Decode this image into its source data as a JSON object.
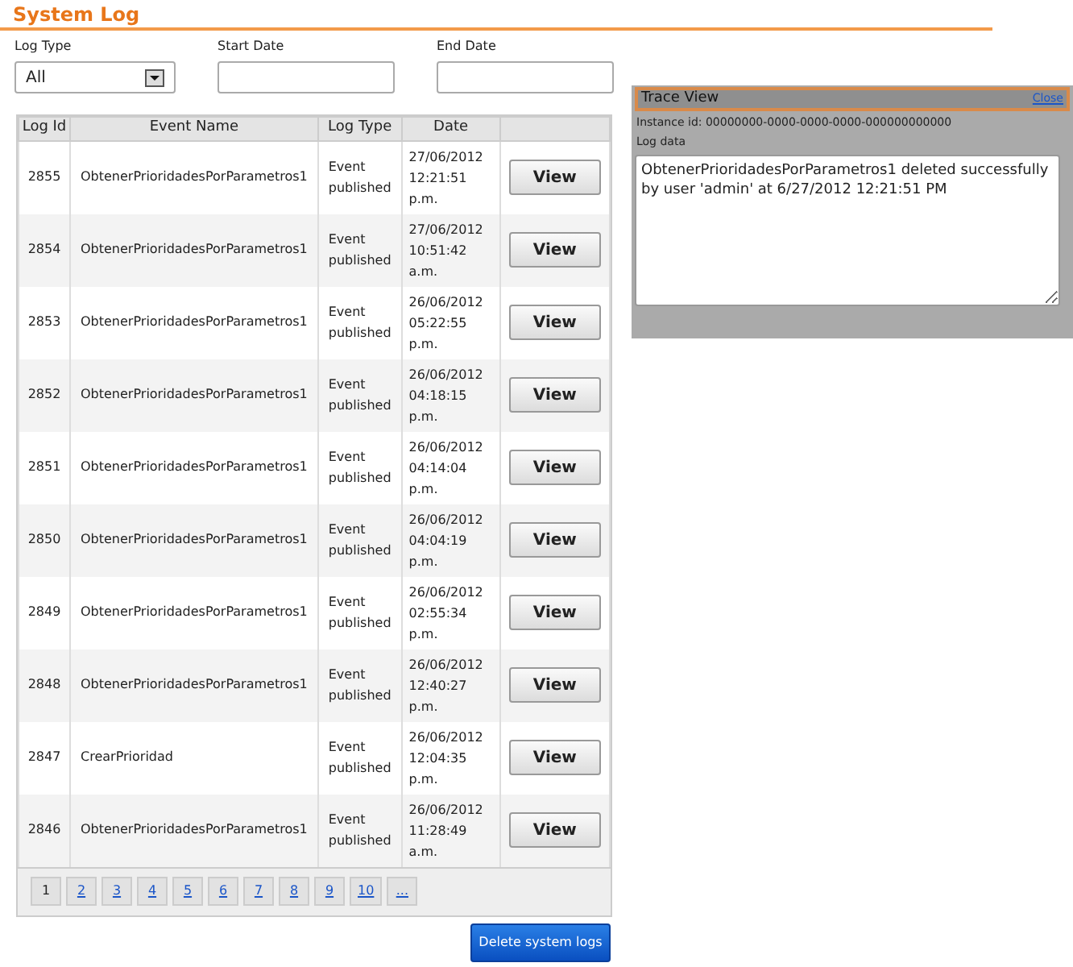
{
  "title": "System Log",
  "filters": {
    "log_type": {
      "label": "Log Type",
      "value": "All"
    },
    "start_date": {
      "label": "Start Date"
    },
    "end_date": {
      "label": "End Date"
    }
  },
  "table": {
    "columns": [
      "Log Id",
      "Event Name",
      "Log Type",
      "Date"
    ],
    "rows": [
      {
        "id": "2855",
        "event": "ObtenerPrioridadesPorParametros1",
        "type": "Event published",
        "date": "27/06/2012 12:21:51 p.m.",
        "action": "View"
      },
      {
        "id": "2854",
        "event": "ObtenerPrioridadesPorParametros1",
        "type": "Event published",
        "date": "27/06/2012 10:51:42 a.m.",
        "action": "View"
      },
      {
        "id": "2853",
        "event": "ObtenerPrioridadesPorParametros1",
        "type": "Event published",
        "date": "26/06/2012 05:22:55 p.m.",
        "action": "View"
      },
      {
        "id": "2852",
        "event": "ObtenerPrioridadesPorParametros1",
        "type": "Event published",
        "date": "26/06/2012 04:18:15 p.m.",
        "action": "View"
      },
      {
        "id": "2851",
        "event": "ObtenerPrioridadesPorParametros1",
        "type": "Event published",
        "date": "26/06/2012 04:14:04 p.m.",
        "action": "View"
      },
      {
        "id": "2850",
        "event": "ObtenerPrioridadesPorParametros1",
        "type": "Event published",
        "date": "26/06/2012 04:04:19 p.m.",
        "action": "View"
      },
      {
        "id": "2849",
        "event": "ObtenerPrioridadesPorParametros1",
        "type": "Event published",
        "date": "26/06/2012 02:55:34 p.m.",
        "action": "View"
      },
      {
        "id": "2848",
        "event": "ObtenerPrioridadesPorParametros1",
        "type": "Event published",
        "date": "26/06/2012 12:40:27 p.m.",
        "action": "View"
      },
      {
        "id": "2847",
        "event": "CrearPrioridad",
        "type": "Event published",
        "date": "26/06/2012 12:04:35 p.m.",
        "action": "View"
      },
      {
        "id": "2846",
        "event": "ObtenerPrioridadesPorParametros1",
        "type": "Event published",
        "date": "26/06/2012 11:28:49 a.m.",
        "action": "View"
      }
    ],
    "pages": [
      {
        "label": "1",
        "selected": true
      },
      {
        "label": "2",
        "selected": false
      },
      {
        "label": "3",
        "selected": false
      },
      {
        "label": "4",
        "selected": false
      },
      {
        "label": "5",
        "selected": false
      },
      {
        "label": "6",
        "selected": false
      },
      {
        "label": "7",
        "selected": false
      },
      {
        "label": "8",
        "selected": false
      },
      {
        "label": "9",
        "selected": false
      },
      {
        "label": "10",
        "selected": false
      },
      {
        "label": "...",
        "selected": false
      }
    ]
  },
  "delete_button": "Delete system logs",
  "trace_view": {
    "title": "Trace View",
    "close": "Close",
    "instance_id": "Instance id: 00000000-0000-0000-0000-000000000000",
    "log_data_label": "Log data",
    "log_data": "ObtenerPrioridadesPorParametros1 deleted successfully by user 'admin' at 6/27/2012 12:21:51 PM"
  }
}
